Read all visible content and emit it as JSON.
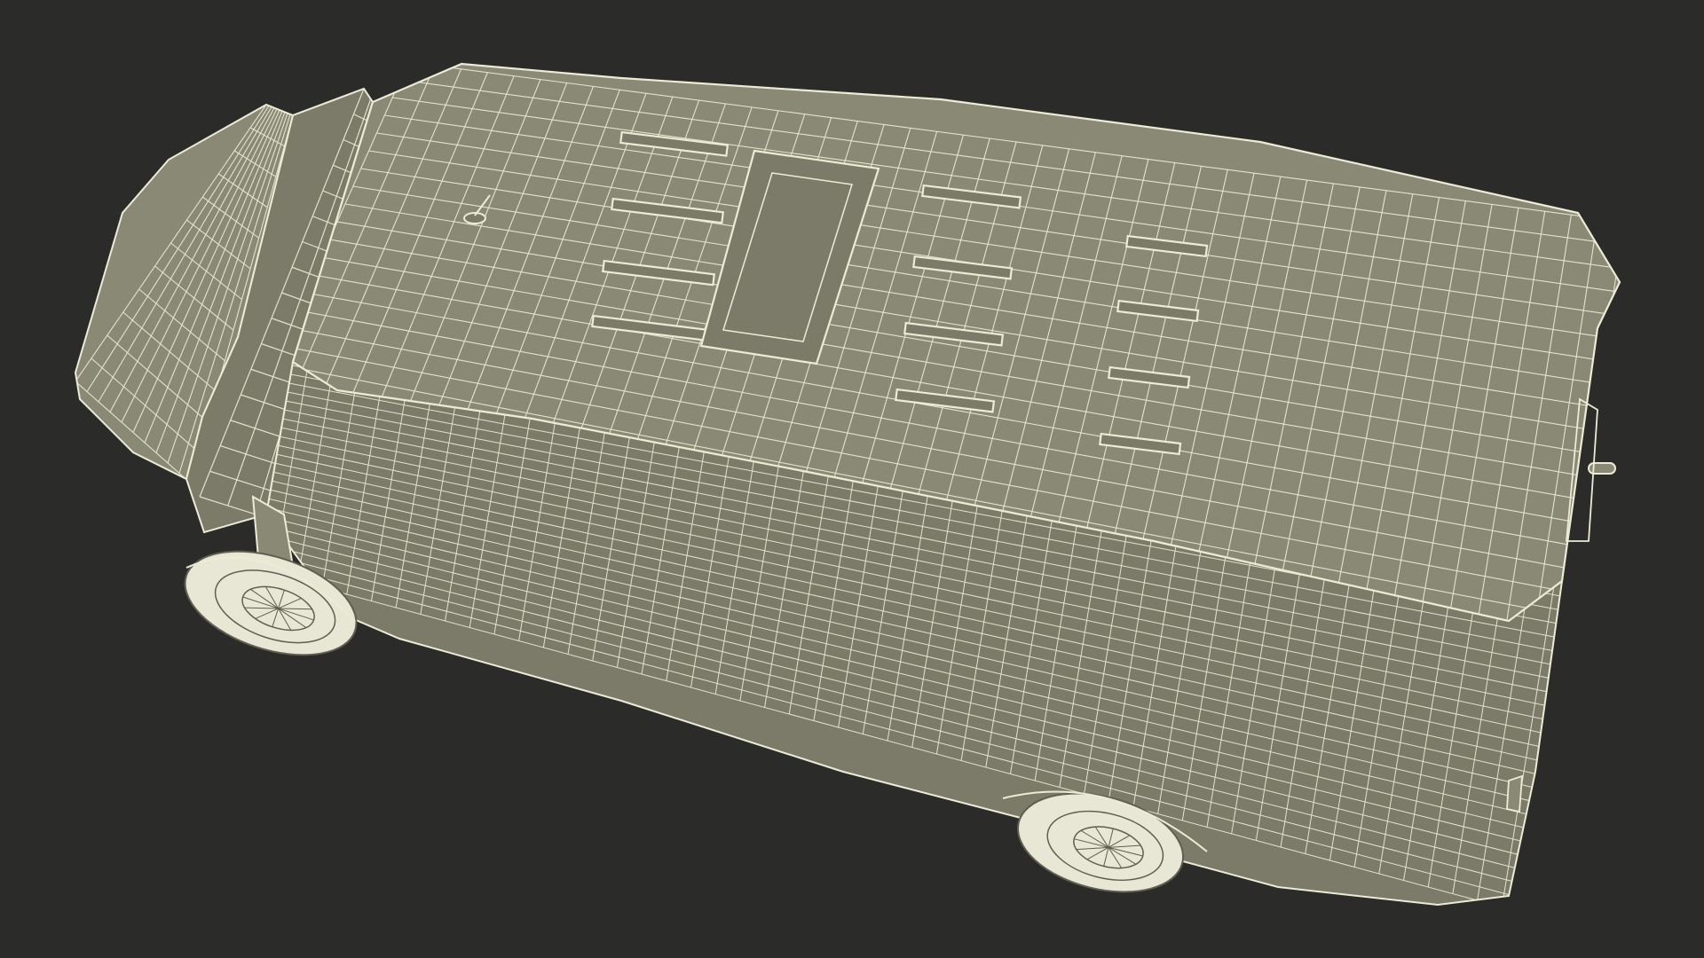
{
  "scene": {
    "subject": "van-wireframe-model",
    "colors": {
      "background": "#2b2b29",
      "surface": "#7c7b69",
      "surface_light": "#8a8975",
      "wire": "#ecebd6",
      "wheel": "#e8e7d5",
      "shadow": "#5f5e50"
    }
  }
}
